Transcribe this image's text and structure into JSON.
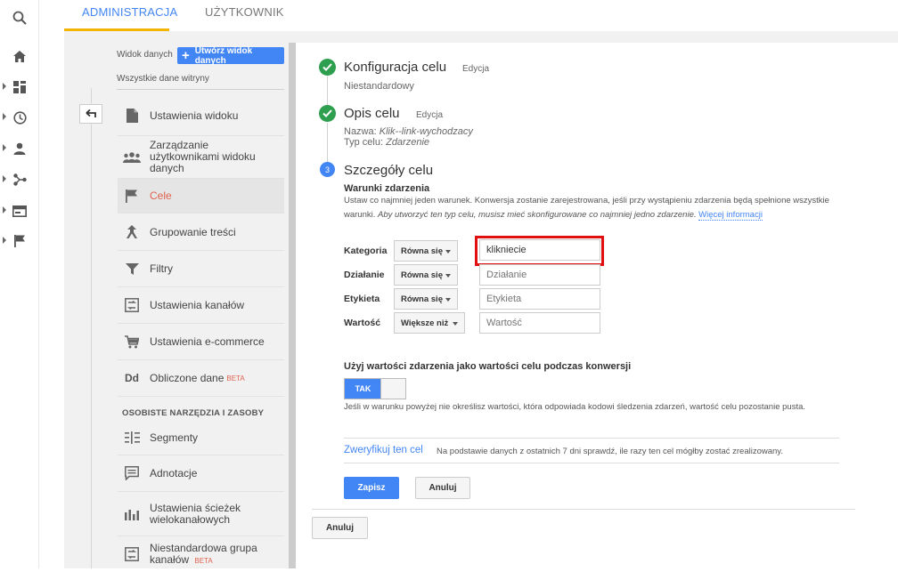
{
  "tabs": [
    {
      "label": "ADMINISTRACJA",
      "active": true
    },
    {
      "label": "UŻYTKOWNIK",
      "active": false
    }
  ],
  "rail": {
    "icons": [
      "search-icon",
      "home-icon",
      "dashboard-icon",
      "clock-icon",
      "person-icon",
      "acquisition-icon",
      "behavior-icon",
      "flag-icon"
    ]
  },
  "admin_nav": {
    "view_label": "Widok danych",
    "create_view_button": "Utwórz widok danych",
    "all_data": "Wszystkie dane witryny",
    "items": [
      {
        "label": "Ustawienia widoku",
        "icon": "document-icon"
      },
      {
        "label": "Zarządzanie użytkownikami widoku danych",
        "icon": "users-icon"
      },
      {
        "label": "Cele",
        "icon": "flag-icon",
        "active": true
      },
      {
        "label": "Grupowanie treści",
        "icon": "grouping-icon"
      },
      {
        "label": "Filtry",
        "icon": "filter-icon"
      },
      {
        "label": "Ustawienia kanałów",
        "icon": "channel-settings-icon"
      },
      {
        "label": "Ustawienia e-commerce",
        "icon": "cart-icon"
      },
      {
        "label": "Obliczone dane",
        "icon": "dd-icon",
        "badge": "BETA"
      }
    ],
    "section_header": "OSOBISTE NARZĘDZIA I ZASOBY",
    "tools": [
      {
        "label": "Segmenty",
        "icon": "segments-icon"
      },
      {
        "label": "Adnotacje",
        "icon": "annotation-icon"
      },
      {
        "label": "Ustawienia ścieżek wielokanałowych",
        "icon": "bar-chart-icon"
      },
      {
        "label": "Niestandardowa grupa kanałów",
        "icon": "channel-group-icon",
        "badge": "BETA"
      }
    ]
  },
  "goal": {
    "step1": {
      "title": "Konfiguracja celu",
      "edit": "Edycja",
      "value": "Niestandardowy"
    },
    "step2": {
      "title": "Opis celu",
      "edit": "Edycja",
      "name_label": "Nazwa:",
      "name_value": "Klik--link-wychodzacy",
      "type_label": "Typ celu:",
      "type_value": "Zdarzenie"
    },
    "step3": {
      "number": "3",
      "title": "Szczegóły celu",
      "conditions_title": "Warunki zdarzenia",
      "desc_line1": "Ustaw co najmniej jeden warunek. Konwersja zostanie zarejestrowana, jeśli przy wystąpieniu zdarzenia będą spełnione wszystkie",
      "desc_line2": "warunki.",
      "desc_italic": "Aby utworzyć ten typ celu, musisz mieć skonfigurowane co najmniej jedno zdarzenie.",
      "more_link": "Więcej informacji",
      "conditions": [
        {
          "label": "Kategoria",
          "operator": "Równa się",
          "value": "klikniecie",
          "placeholder": "Kategoria"
        },
        {
          "label": "Działanie",
          "operator": "Równa się",
          "value": "",
          "placeholder": "Działanie"
        },
        {
          "label": "Etykieta",
          "operator": "Równa się",
          "value": "",
          "placeholder": "Etykieta"
        },
        {
          "label": "Wartość",
          "operator": "Większe niż",
          "value": "",
          "placeholder": "Wartość"
        }
      ],
      "use_value_label": "Użyj wartości zdarzenia jako wartości celu podczas konwersji",
      "toggle_label": "TAK",
      "toggle_note": "Jeśli w warunku powyżej nie określisz wartości, która odpowiada kodowi śledzenia zdarzeń, wartość celu pozostanie pusta.",
      "verify_link": "Zweryfikuj ten cel",
      "verify_desc": "Na podstawie danych z ostatnich 7 dni sprawdź, ile razy ten cel mógłby zostać zrealizowany.",
      "save_button": "Zapisz",
      "cancel_button": "Anuluj"
    },
    "outer_cancel_button": "Anuluj"
  },
  "colors": {
    "accent": "#4285f4",
    "active_nav": "#e06250",
    "check": "#2e9e4f",
    "highlight": "#e01010",
    "tab_underline": "#f4b400"
  }
}
